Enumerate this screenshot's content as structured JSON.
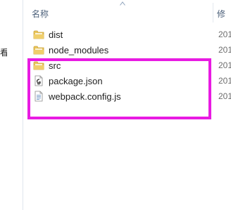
{
  "header": {
    "name_column": "名称",
    "date_column_fragment": "修"
  },
  "nav": {
    "fragment": "看"
  },
  "files": [
    {
      "name": "dist",
      "type": "folder",
      "icon": "folder-icon",
      "date_fragment": "201"
    },
    {
      "name": "node_modules",
      "type": "folder",
      "icon": "folder-icon",
      "date_fragment": "201"
    },
    {
      "name": "src",
      "type": "folder",
      "icon": "folder-icon",
      "date_fragment": "201"
    },
    {
      "name": "package.json",
      "type": "file",
      "icon": "json-file-icon",
      "date_fragment": "201"
    },
    {
      "name": "webpack.config.js",
      "type": "file",
      "icon": "js-file-icon",
      "date_fragment": "201"
    }
  ],
  "colors": {
    "highlight": "#e81be2",
    "header_text": "#4c607a",
    "folder": "#e9c55c"
  }
}
